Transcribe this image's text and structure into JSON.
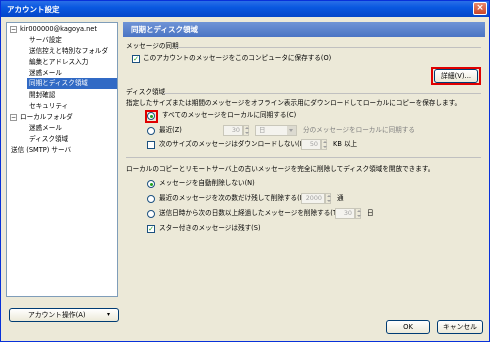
{
  "window": {
    "title": "アカウント設定",
    "close_glyph": "×"
  },
  "tree": {
    "account_collapse_glyph": "−",
    "local_collapse_glyph": "−",
    "items": [
      {
        "label": "kir000000@kagoya.net"
      },
      {
        "label": "サーバ設定"
      },
      {
        "label": "送信控えと特別なフォルダ"
      },
      {
        "label": "編集とアドレス入力"
      },
      {
        "label": "迷惑メール"
      },
      {
        "label": "同期とディスク領域"
      },
      {
        "label": "開封確認"
      },
      {
        "label": "セキュリティ"
      },
      {
        "label": "ローカルフォルダ"
      },
      {
        "label": "迷惑メール"
      },
      {
        "label": "ディスク領域"
      },
      {
        "label": "送信 (SMTP) サーバ"
      }
    ],
    "account_actions_label": "アカウント操作(A)",
    "account_actions_arrow": "▾"
  },
  "pane": {
    "header": "同期とディスク領域",
    "sync": {
      "title": "メッセージの同期",
      "keep_local_label": "このアカウントのメッセージをこのコンピュータに保存する(O)",
      "keep_local_checked": true,
      "details_button": "詳細(V)..."
    },
    "disk": {
      "title": "ディスク領域",
      "description": "指定したサイズまたは期間のメッセージをオフライン表示用にダウンロードしてローカルにコピーを保存します。",
      "sync_all_label": "すべてのメッセージをローカルに同期する(C)",
      "recent_label": "最近(Z)",
      "recent_value": "30",
      "recent_unit": "日",
      "recent_suffix": "分のメッセージをローカルに同期する",
      "size_label": "次のサイズのメッセージはダウンロードしない(M):",
      "size_value": "50",
      "size_unit": "KB 以上"
    },
    "cleanup": {
      "description": "ローカルのコピーとリモートサーバ上の古いメッセージを完全に削除してディスク領域を開放できます。",
      "dont_delete_label": "メッセージを自動削除しない(N)",
      "keep_recent_label": "最近のメッセージを次の数だけ残して削除する(B)",
      "keep_recent_value": "2000",
      "keep_recent_unit": "通",
      "delete_older_label": "送信日時から次の日数以上経過したメッセージを削除する(T)",
      "delete_older_value": "30",
      "delete_older_unit": "日",
      "keep_starred_label": "スター付きのメッセージは残す(S)",
      "keep_starred_checked": true
    }
  },
  "footer": {
    "ok": "OK",
    "cancel": "キャンセル"
  },
  "colors": {
    "highlight": "#e00000",
    "selected": "#316ac5",
    "header": "#4a74c4",
    "check": "#21a121"
  }
}
